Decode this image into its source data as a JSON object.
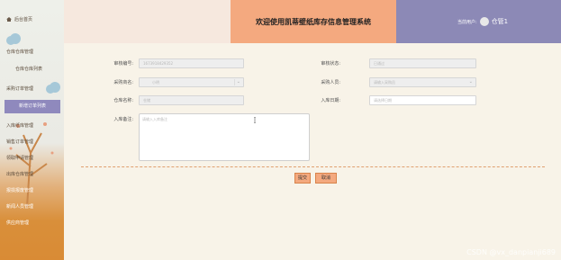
{
  "sidebar": {
    "items": [
      {
        "label": "后台首页"
      },
      {
        "label": "仓库仓库管理"
      },
      {
        "label": "仓库仓库列表"
      },
      {
        "label": "采购订单管理"
      },
      {
        "label": "新增订单列表"
      },
      {
        "label": "入库纸库管理"
      },
      {
        "label": "销售订单管理"
      },
      {
        "label": "领取申请管理"
      },
      {
        "label": "出库仓库管理"
      },
      {
        "label": "报损报废管理"
      },
      {
        "label": "新闻人员管理"
      },
      {
        "label": "供应商管理"
      }
    ]
  },
  "header": {
    "title": "欢迎使用凯蒂壁纸库存信息管理系统",
    "current_user_label": "当前用户:",
    "user_name": "仓管1"
  },
  "form": {
    "order_no": {
      "label": "审核编号:",
      "value": "1673918429352"
    },
    "review_status": {
      "label": "审核状态:",
      "value": "已通过"
    },
    "supplier": {
      "label": "采购商名:",
      "value": "小明"
    },
    "purchaser": {
      "label": "采购人员:",
      "value": "请输入采购员"
    },
    "warehouse": {
      "label": "仓库名称:",
      "value": "仓储"
    },
    "in_date": {
      "label": "入库日期:",
      "placeholder": "请选择日期"
    },
    "remark": {
      "label": "入库备注:",
      "placeholder": "请输入入库备注"
    }
  },
  "buttons": {
    "submit": "提交",
    "cancel": "取消"
  },
  "watermark": "CSDN @vx_danpianji689",
  "colors": {
    "accent_orange": "#f4a97f",
    "accent_purple": "#8c89b6"
  }
}
